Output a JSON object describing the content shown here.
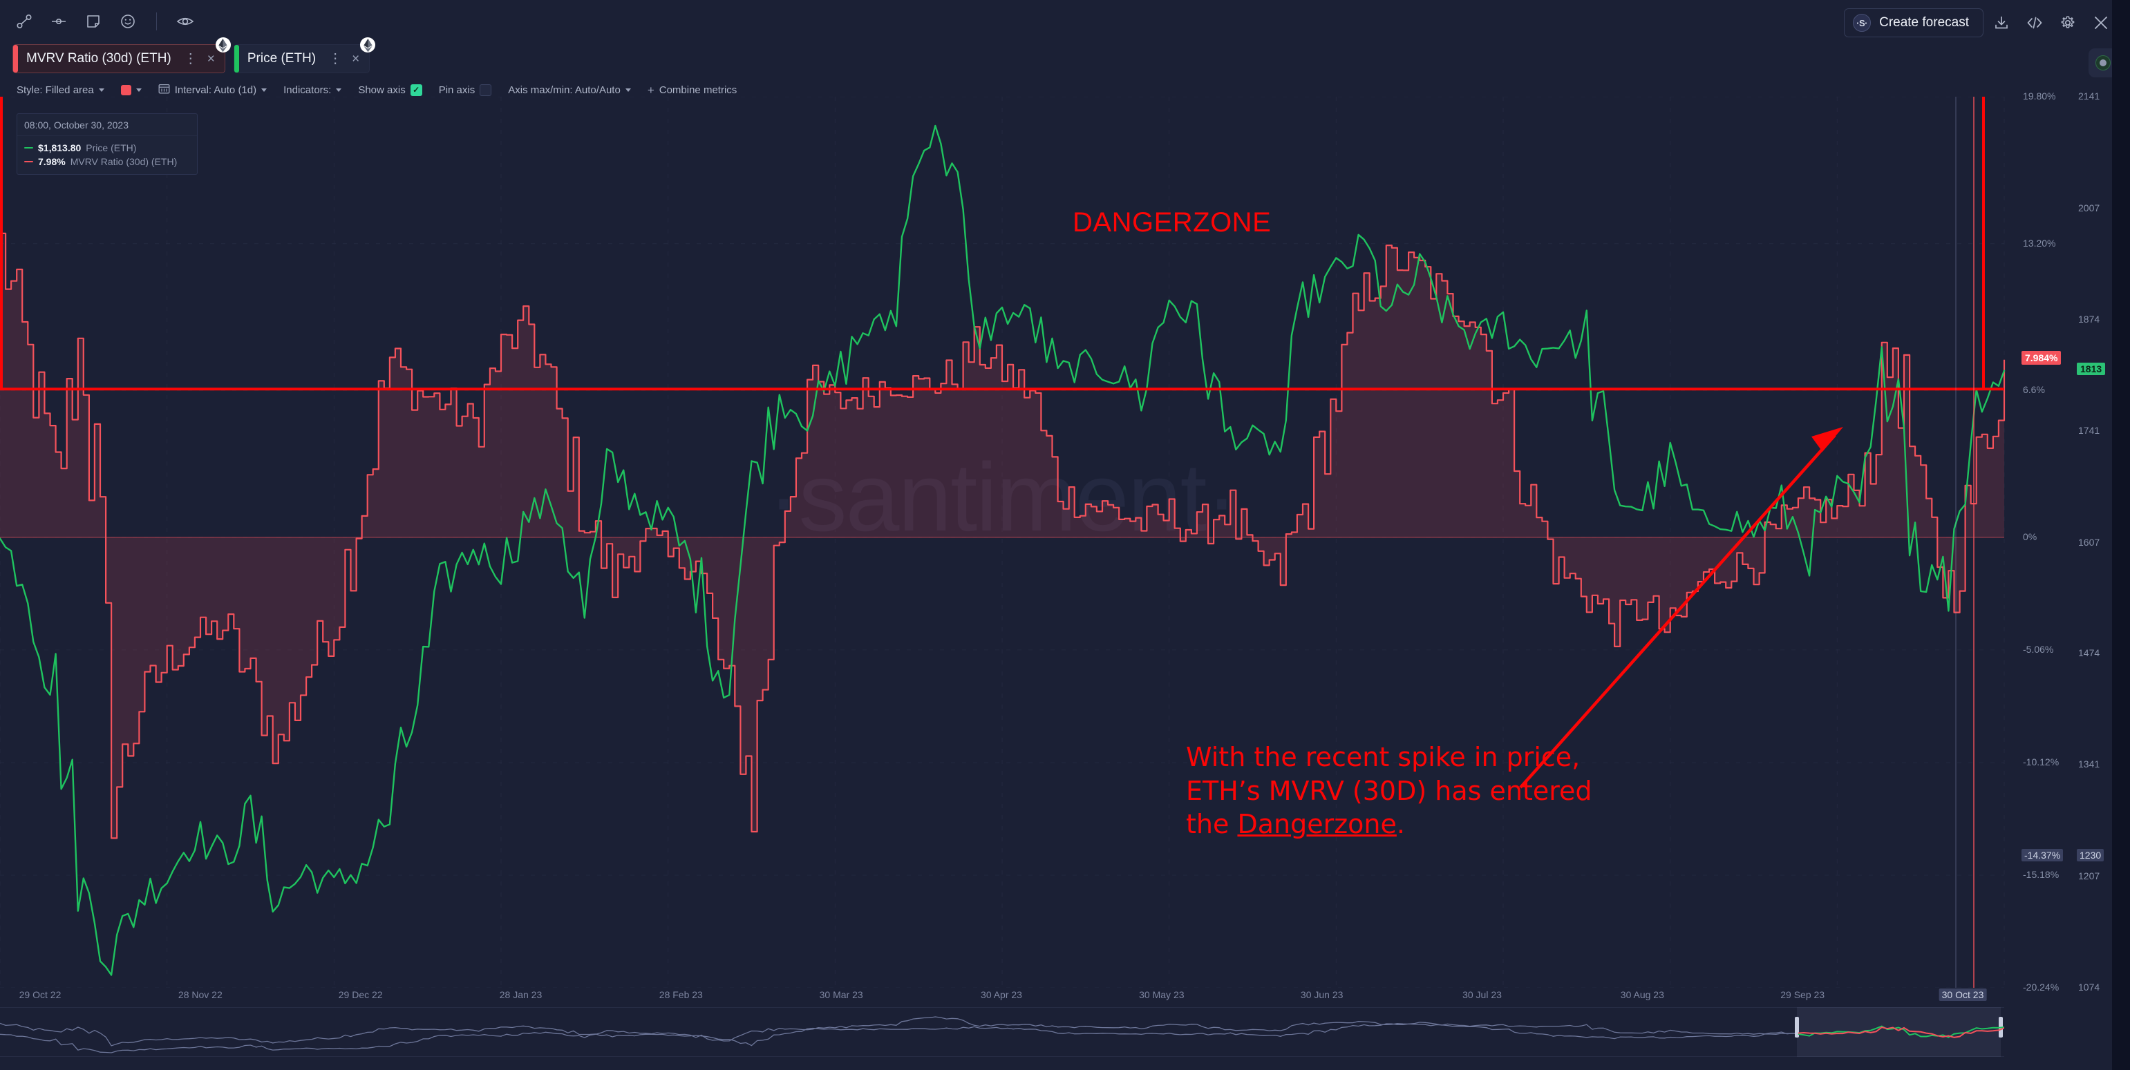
{
  "toolbar_icons": [
    {
      "name": "trend-line-icon",
      "label": "Trend line"
    },
    {
      "name": "horizontal-line-icon",
      "label": "Horizontal line"
    },
    {
      "name": "note-icon",
      "label": "Note"
    },
    {
      "name": "emoji-icon",
      "label": "Emoji"
    },
    {
      "name": "eye-icon",
      "label": "Toggle visibility"
    }
  ],
  "header": {
    "forecast_label": "Create forecast",
    "brand_mark": "·S·",
    "download_label": "Download",
    "embed_label": "Embed",
    "settings_label": "Settings",
    "close_label": "Close",
    "record_label": "Record"
  },
  "tabs": [
    {
      "label": "MVRV Ratio (30d) (ETH)",
      "color": "#f4525b",
      "asset": "ETH",
      "menu": "⋮",
      "close": "×"
    },
    {
      "label": "Price (ETH)",
      "color": "#1fc35f",
      "asset": "ETH",
      "menu": "⋮",
      "close": "×"
    }
  ],
  "settings_bar": {
    "style_label": "Style: Filled area",
    "color_value": "#f4525b",
    "interval_label": "Interval: Auto (1d)",
    "indicators_label": "Indicators:",
    "show_axis_label": "Show axis",
    "show_axis_checked": true,
    "pin_axis_label": "Pin axis",
    "pin_axis_checked": false,
    "axis_minmax_label": "Axis max/min: Auto/Auto",
    "combine_label": "Combine metrics",
    "combine_plus": "+"
  },
  "legend": {
    "date": "08:00, October 30, 2023",
    "rows": [
      {
        "value": "$1,813.80",
        "name": "Price (ETH)",
        "color": "#1fc35f"
      },
      {
        "value": "7.98%",
        "name": "MVRV Ratio (30d) (ETH)",
        "color": "#f4525b"
      }
    ]
  },
  "watermark": "·santiment·",
  "annotations": {
    "dangerzone_label": "DANGERZONE",
    "note_line1": "With the recent spike in price,",
    "note_line2": "ETH’s MVRV (30D) has entered",
    "note_line3_pre": "the ",
    "note_line3_link": "Dangerzone",
    "note_line3_post": ".",
    "accent_color": "#fc0606"
  },
  "chart_data": {
    "type": "line",
    "title": "MVRV Ratio (30d) (ETH) vs Price (ETH)",
    "xlabel": "",
    "grid": true,
    "legend_position": "top-left",
    "x_tick_labels": [
      "29 Oct 22",
      "28 Nov 22",
      "29 Dec 22",
      "28 Jan 23",
      "28 Feb 23",
      "30 Mar 23",
      "30 Apr 23",
      "30 May 23",
      "30 Jun 23",
      "30 Jul 23",
      "30 Aug 23",
      "29 Sep 23",
      "30 Oct 23"
    ],
    "x_tick_highlight": "30 Oct 23",
    "axes": [
      {
        "name": "MVRV Ratio (30d) (ETH)",
        "color": "#f4525b",
        "unit": "%",
        "side": "right-inner",
        "ylim": [
          -20.24,
          19.8
        ],
        "ticks": [
          "19.80%",
          "13.20%",
          "6.6%",
          "0%",
          "-5.06%",
          "-10.12%",
          "-15.18%",
          "-20.24%"
        ],
        "highlight_ticks": [
          "7.984%",
          "-14.37%"
        ],
        "current_value": "7.984%"
      },
      {
        "name": "Price (ETH)",
        "color": "#1fc35f",
        "unit": "USD",
        "side": "right-outer",
        "ylim": [
          1074,
          2141
        ],
        "ticks": [
          "2141",
          "2007",
          "1874",
          "1741",
          "1607",
          "1474",
          "1341",
          "1207",
          "1074"
        ],
        "highlight_ticks": [
          "1813",
          "1230"
        ],
        "current_value": "1813"
      }
    ],
    "series": [
      {
        "name": "MVRV Ratio (30d) (ETH)",
        "color": "#f4525b",
        "fill": "rgba(244,82,91,0.16)",
        "style": "filled area",
        "unit": "%",
        "x": [
          "29 Oct 22",
          "03 Nov 22",
          "08 Nov 22",
          "13 Nov 22",
          "18 Nov 22",
          "23 Nov 22",
          "28 Nov 22",
          "03 Dec 22",
          "08 Dec 22",
          "13 Dec 22",
          "18 Dec 22",
          "23 Dec 22",
          "29 Dec 22",
          "03 Jan 23",
          "08 Jan 23",
          "13 Jan 23",
          "18 Jan 23",
          "23 Jan 23",
          "28 Jan 23",
          "02 Feb 23",
          "07 Feb 23",
          "12 Feb 23",
          "17 Feb 23",
          "22 Feb 23",
          "28 Feb 23",
          "05 Mar 23",
          "10 Mar 23",
          "15 Mar 23",
          "20 Mar 23",
          "25 Mar 23",
          "30 Mar 23",
          "04 Apr 23",
          "09 Apr 23",
          "14 Apr 23",
          "19 Apr 23",
          "24 Apr 23",
          "30 Apr 23",
          "05 May 23",
          "10 May 23",
          "15 May 23",
          "20 May 23",
          "25 May 23",
          "30 May 23",
          "04 Jun 23",
          "09 Jun 23",
          "14 Jun 23",
          "19 Jun 23",
          "24 Jun 23",
          "30 Jun 23",
          "05 Jul 23",
          "10 Jul 23",
          "15 Jul 23",
          "20 Jul 23",
          "25 Jul 23",
          "30 Jul 23",
          "04 Aug 23",
          "09 Aug 23",
          "14 Aug 23",
          "19 Aug 23",
          "24 Aug 23",
          "30 Aug 23",
          "04 Sep 23",
          "09 Sep 23",
          "14 Sep 23",
          "19 Sep 23",
          "24 Sep 23",
          "29 Sep 23",
          "04 Oct 23",
          "09 Oct 23",
          "14 Oct 23",
          "19 Oct 23",
          "24 Oct 23",
          "30 Oct 23"
        ],
        "values": [
          13.0,
          7.9,
          2.5,
          10.0,
          -12.0,
          -7.5,
          -5.5,
          -4.5,
          -4.0,
          -6.5,
          -9.5,
          -6.0,
          -3.5,
          2.0,
          8.0,
          6.5,
          6.0,
          5.0,
          8.5,
          9.6,
          5.5,
          1.0,
          -2.0,
          0.2,
          -1.0,
          -1.2,
          -6.5,
          -11.0,
          0.5,
          7.0,
          6.0,
          6.5,
          7.0,
          6.8,
          7.0,
          8.5,
          7.5,
          6.5,
          2.0,
          1.5,
          1.2,
          0.6,
          1.0,
          0.2,
          1.5,
          -1.0,
          -1.5,
          2.0,
          6.5,
          11.0,
          12.5,
          12.0,
          10.5,
          10.0,
          6.0,
          1.5,
          -1.5,
          -2.5,
          -4.0,
          -3.0,
          -4.5,
          -2.0,
          -1.5,
          -1.0,
          0.5,
          1.5,
          1.0,
          3.0,
          8.8,
          1.5,
          -2.5,
          3.0,
          7.98
        ]
      },
      {
        "name": "Price (ETH)",
        "color": "#1fc35f",
        "style": "line",
        "unit": "USD",
        "x": [
          "29 Oct 22",
          "03 Nov 22",
          "08 Nov 22",
          "13 Nov 22",
          "18 Nov 22",
          "23 Nov 22",
          "28 Nov 22",
          "03 Dec 22",
          "08 Dec 22",
          "13 Dec 22",
          "18 Dec 22",
          "23 Dec 22",
          "29 Dec 22",
          "03 Jan 23",
          "08 Jan 23",
          "13 Jan 23",
          "18 Jan 23",
          "23 Jan 23",
          "28 Jan 23",
          "02 Feb 23",
          "07 Feb 23",
          "12 Feb 23",
          "17 Feb 23",
          "22 Feb 23",
          "28 Feb 23",
          "05 Mar 23",
          "10 Mar 23",
          "15 Mar 23",
          "20 Mar 23",
          "25 Mar 23",
          "30 Mar 23",
          "04 Apr 23",
          "09 Apr 23",
          "14 Apr 23",
          "19 Apr 23",
          "24 Apr 23",
          "30 Apr 23",
          "05 May 23",
          "10 May 23",
          "15 May 23",
          "20 May 23",
          "25 May 23",
          "30 May 23",
          "04 Jun 23",
          "09 Jun 23",
          "14 Jun 23",
          "19 Jun 23",
          "24 Jun 23",
          "30 Jun 23",
          "05 Jul 23",
          "10 Jul 23",
          "15 Jul 23",
          "20 Jul 23",
          "25 Jul 23",
          "30 Jul 23",
          "04 Aug 23",
          "09 Aug 23",
          "14 Aug 23",
          "19 Aug 23",
          "24 Aug 23",
          "30 Aug 23",
          "04 Sep 23",
          "09 Sep 23",
          "14 Sep 23",
          "19 Sep 23",
          "24 Sep 23",
          "29 Sep 23",
          "04 Oct 23",
          "09 Oct 23",
          "14 Oct 23",
          "19 Oct 23",
          "24 Oct 23",
          "30 Oct 23"
        ],
        "values": [
          1607,
          1560,
          1420,
          1190,
          1110,
          1180,
          1210,
          1260,
          1230,
          1280,
          1180,
          1215,
          1195,
          1220,
          1280,
          1420,
          1560,
          1600,
          1580,
          1640,
          1660,
          1520,
          1700,
          1650,
          1630,
          1570,
          1440,
          1680,
          1780,
          1760,
          1800,
          1860,
          1870,
          2080,
          2100,
          1850,
          1880,
          1880,
          1810,
          1820,
          1810,
          1790,
          1900,
          1870,
          1740,
          1730,
          1720,
          1900,
          1930,
          1960,
          1880,
          1930,
          1880,
          1850,
          1870,
          1830,
          1850,
          1840,
          1660,
          1650,
          1700,
          1630,
          1640,
          1620,
          1650,
          1600,
          1670,
          1650,
          1870,
          1560,
          1580,
          1780,
          1813
        ]
      }
    ],
    "overlays": [
      {
        "type": "hline",
        "label": "Dangerzone threshold",
        "value": "6.6%",
        "color": "#fc0606"
      },
      {
        "type": "rect",
        "label": "Dangerzone box",
        "from": "19.80%",
        "to": "6.6%",
        "color": "#fc0606"
      },
      {
        "type": "arrow",
        "label": "Rising trend arrow",
        "color": "#fc0606"
      }
    ]
  }
}
